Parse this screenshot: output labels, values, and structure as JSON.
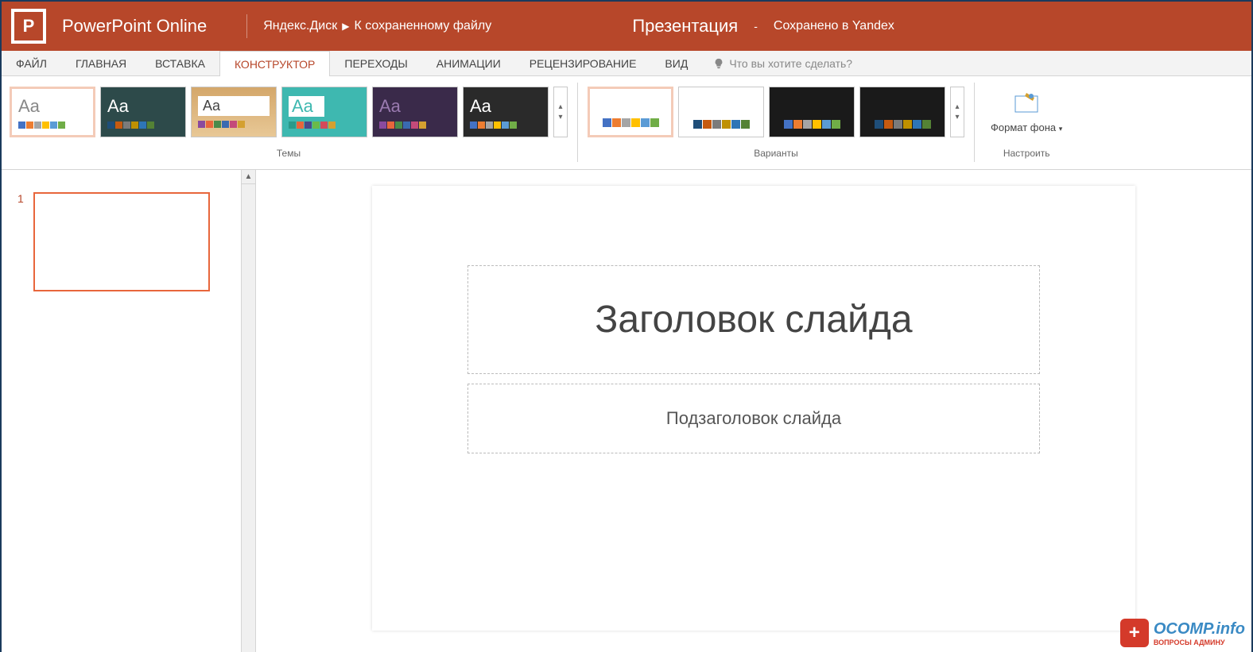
{
  "header": {
    "app_name": "PowerPoint Online",
    "breadcrumb_location": "Яндекс.Диск",
    "breadcrumb_file": "К сохраненному файлу",
    "document_name": "Презентация",
    "saved_status": "Сохранено в Yandex"
  },
  "ribbon": {
    "tabs": [
      "ФАЙЛ",
      "ГЛАВНАЯ",
      "ВСТАВКА",
      "КОНСТРУКТОР",
      "ПЕРЕХОДЫ",
      "АНИМАЦИИ",
      "РЕЦЕНЗИРОВАНИЕ",
      "ВИД"
    ],
    "active_tab_index": 3,
    "tell_me_placeholder": "Что вы хотите сделать?",
    "groups": {
      "themes_label": "Темы",
      "variants_label": "Варианты",
      "customize_label": "Настроить",
      "format_bg_label": "Формат фона"
    }
  },
  "slides": {
    "panel": [
      {
        "number": "1"
      }
    ]
  },
  "canvas": {
    "title_placeholder": "Заголовок слайда",
    "subtitle_placeholder": "Подзаголовок слайда"
  },
  "watermark": {
    "main": "OCOMP.info",
    "sub": "ВОПРОСЫ АДМИНУ"
  }
}
